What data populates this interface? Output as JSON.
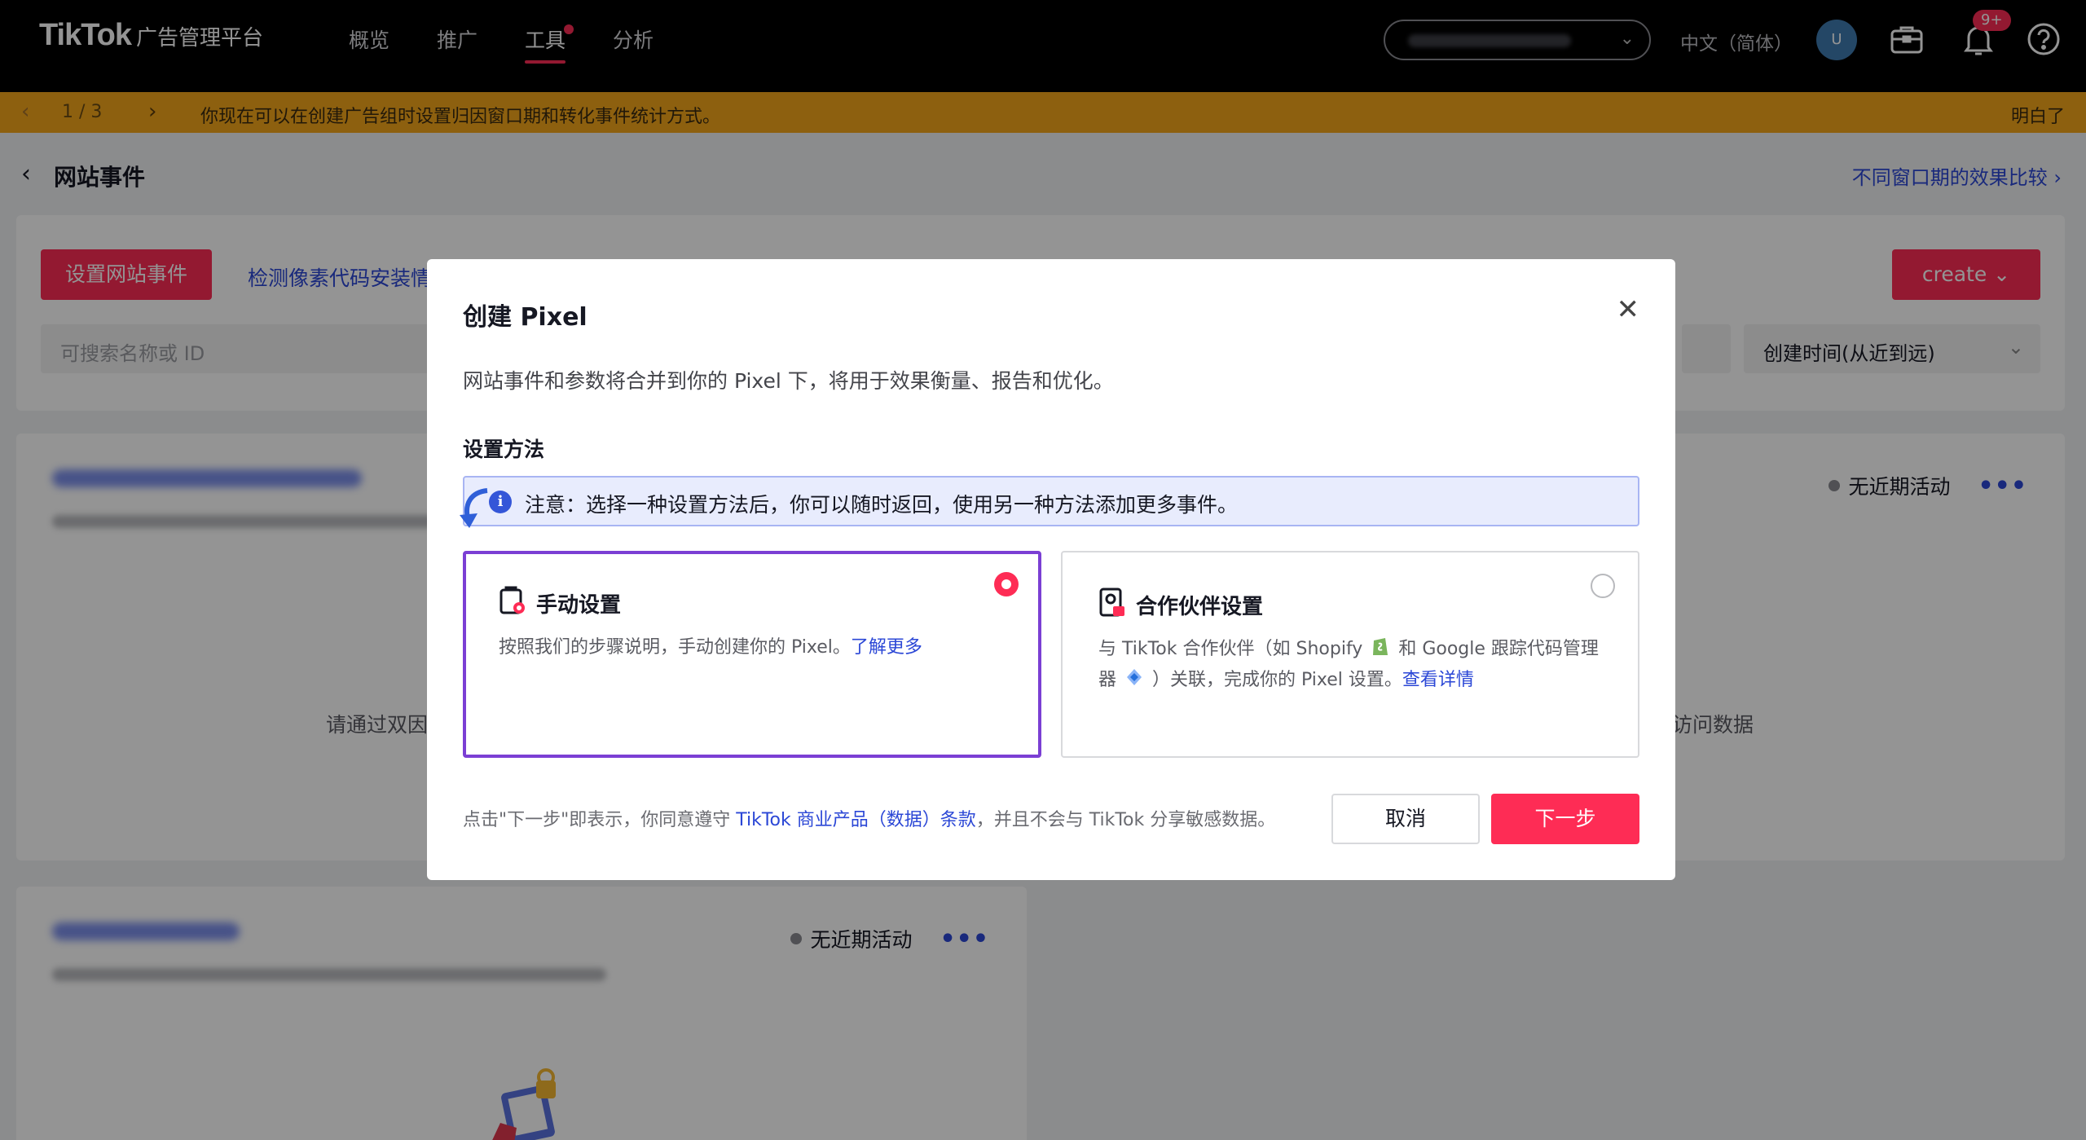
{
  "topbar": {
    "logo_main": "TikTok",
    "logo_sub": "广告管理平台",
    "nav": [
      "概览",
      "推广",
      "工具",
      "分析"
    ],
    "language": "中文（简体）",
    "avatar_initial": "U",
    "notification_badge": "9+"
  },
  "announcement": {
    "page": "1 / 3",
    "text": "你现在可以在创建广告组时设置归因窗口期和转化事件统计方式。",
    "dismiss": "明白了"
  },
  "page": {
    "title": "网站事件",
    "compare_link": "不同窗口期的效果比较"
  },
  "toolbar": {
    "setup_button": "设置网站事件",
    "detect_link": "检测像素代码安装情",
    "create_button": "create",
    "search_placeholder": "可搜索名称或 ID",
    "sort_value": "创建时间(从近到远)"
  },
  "cards": {
    "status": "无近期活动",
    "empty_tip_left": "请通过双因",
    "empty_tip_right": "访问数据"
  },
  "modal": {
    "title": "创建 Pixel",
    "description": "网站事件和参数将合并到你的 Pixel 下，将用于效果衡量、报告和优化。",
    "section_label": "设置方法",
    "notice": "注意：选择一种设置方法后，你可以随时返回，使用另一种方法添加更多事件。",
    "options": [
      {
        "title": "手动设置",
        "desc": "按照我们的步骤说明，手动创建你的 Pixel。",
        "link": "了解更多",
        "selected": true
      },
      {
        "title": "合作伙伴设置",
        "desc_1": "与 TikTok 合作伙伴（如 Shopify",
        "desc_2": "和 Google 跟踪代码管理器",
        "desc_3": "）关联，完成你的 Pixel 设置。",
        "link": "查看详情",
        "selected": false
      }
    ],
    "footer_pre": "点击\"下一步\"即表示，你同意遵守 ",
    "footer_link": "TikTok 商业产品（数据）条款",
    "footer_post": "，并且不会与 TikTok 分享敏感数据。",
    "cancel": "取消",
    "next": "下一步"
  },
  "colors": {
    "brand": "#fe2c55",
    "link": "#2b47d6",
    "selected_border": "#7b3fd4",
    "announce_bg": "#f3a51b"
  }
}
